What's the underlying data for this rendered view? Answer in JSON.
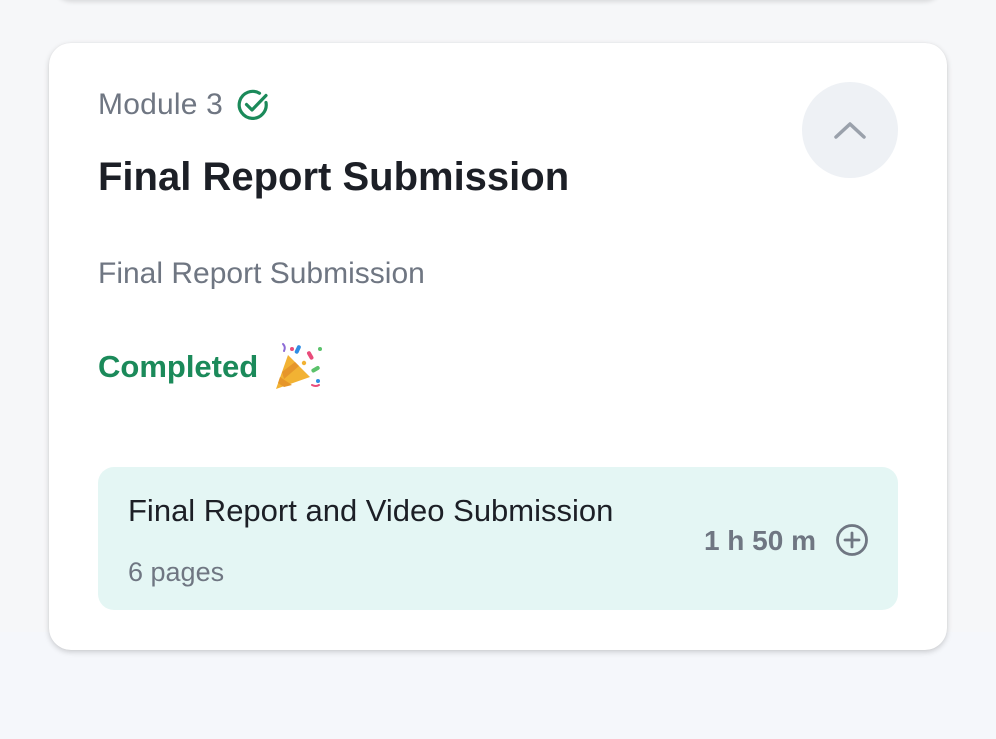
{
  "module": {
    "label": "Module 3",
    "title": "Final Report Submission",
    "subtitle": "Final Report Submission",
    "status": "Completed",
    "status_icon": "party-popper-icon",
    "completed_icon": "check-circle-icon",
    "collapse_icon": "chevron-up-icon"
  },
  "lessons": [
    {
      "title": "Final Report and Video Submission",
      "pages": "6 pages",
      "duration": "1 h 50 m",
      "action_icon": "plus-circle-icon"
    }
  ],
  "colors": {
    "accent_green": "#1b8a5a",
    "lesson_bg": "#e4f6f4",
    "muted_text": "#6f7682",
    "title_text": "#1c1f26"
  }
}
